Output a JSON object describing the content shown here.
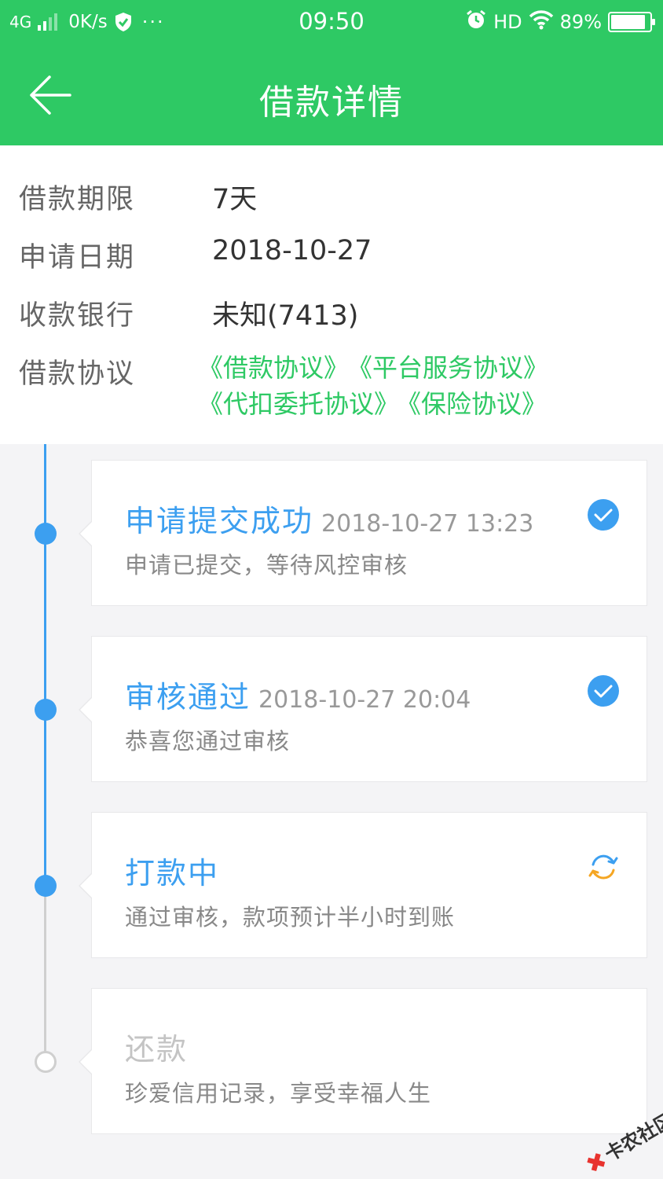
{
  "status_bar": {
    "network": "4G",
    "speed": "0K/s",
    "dots": "···",
    "time": "09:50",
    "hd": "HD",
    "battery": "89%",
    "battery_level": 0.89
  },
  "nav": {
    "title": "借款详情",
    "back_icon": "arrow-left-icon"
  },
  "details": {
    "rows": [
      {
        "label": "借款期限",
        "value": "7天"
      },
      {
        "label": "申请日期",
        "value": "2018-10-27"
      },
      {
        "label": "收款银行",
        "value": "未知(7413)"
      }
    ],
    "agreement_label": "借款协议",
    "agreements": [
      "《借款协议》",
      "《平台服务协议》",
      "《代扣委托协议》",
      "《保险协议》"
    ]
  },
  "timeline": {
    "steps": [
      {
        "title": "申请提交成功",
        "time": "2018-10-27 13:23",
        "desc": "申请已提交，等待风控审核",
        "status": "done",
        "icon": "check-circle-icon"
      },
      {
        "title": "审核通过",
        "time": "2018-10-27 20:04",
        "desc": "恭喜您通过审核",
        "status": "done",
        "icon": "check-circle-icon"
      },
      {
        "title": "打款中",
        "time": "",
        "desc": "通过审核，款项预计半小时到账",
        "status": "in-progress",
        "icon": "refresh-icon"
      },
      {
        "title": "还款",
        "time": "",
        "desc": "珍爱信用记录，享受幸福人生",
        "status": "pending",
        "icon": ""
      }
    ]
  },
  "colors": {
    "brand_green": "#2ec964",
    "timeline_blue": "#3c9ff0",
    "progress_orange": "#f5a623"
  },
  "watermark": {
    "text": "卡农社区"
  }
}
